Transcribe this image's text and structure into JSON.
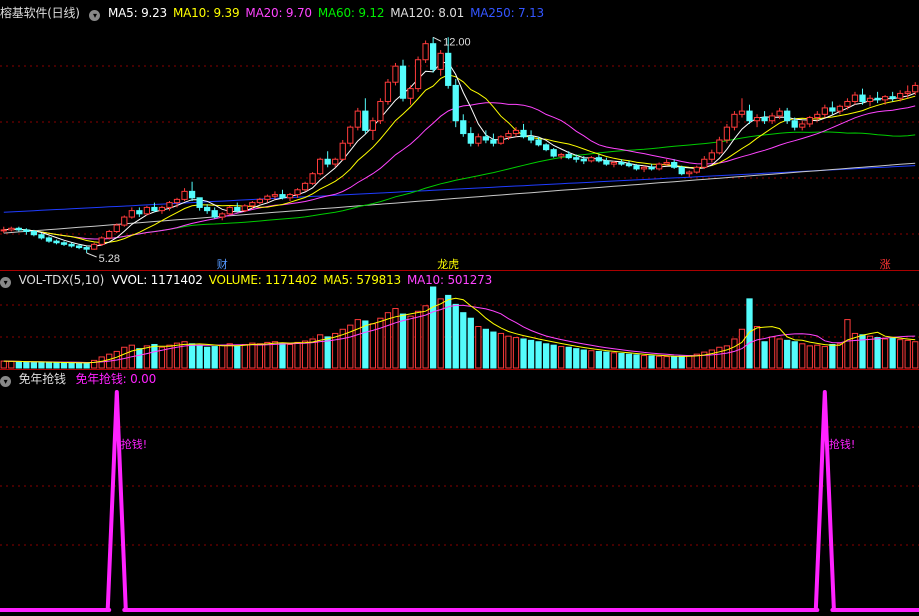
{
  "panel_price": {
    "title": "榕基软件(日线)",
    "ma_labels": [
      {
        "text": "MA5: 9.23",
        "color": "#ffffff"
      },
      {
        "text": "MA10: 9.39",
        "color": "#ffff00"
      },
      {
        "text": "MA20: 9.70",
        "color": "#ff44ff"
      },
      {
        "text": "MA60: 9.12",
        "color": "#00ee00"
      },
      {
        "text": "MA120: 8.01",
        "color": "#dddddd"
      },
      {
        "text": "MA250: 7.13",
        "color": "#3355ff"
      }
    ]
  },
  "panel_volume": {
    "title": "VOL-TDX(5,10)",
    "labels": [
      {
        "text": "VVOL: 1171402",
        "color": "#ffffff"
      },
      {
        "text": "VOLUME: 1171402",
        "color": "#ffff00"
      },
      {
        "text": "MA5: 579813",
        "color": "#ffff00"
      },
      {
        "text": "MA10: 501273",
        "color": "#ff44ff"
      }
    ]
  },
  "panel_indicator": {
    "title": "免年抢钱",
    "value_label": "免年抢钱: 0.00",
    "signal_text": "抢钱!"
  },
  "event_markers": [
    {
      "text": "财",
      "bar": 29,
      "color": "#5599ff"
    },
    {
      "text": "龙虎",
      "bar": 59,
      "color": "#ffff00"
    },
    {
      "text": "涨",
      "bar": 117,
      "color": "#ff3333"
    }
  ],
  "colors": {
    "up": "#ff3b3b",
    "down": "#54fcfc",
    "ma5": "#ffffff",
    "ma10": "#ffff00",
    "ma20": "#ff44ff",
    "ma60": "#00cc00",
    "ma120": "#c8c8c8",
    "ma250": "#1f3cff",
    "signal": "#ff22ff",
    "grid": "#8a0000"
  },
  "chart_data": [
    {
      "type": "candlestick",
      "title": "榕基软件(日线)",
      "high_label": "12.00",
      "low_label": "5.28",
      "ylim": [
        5.0,
        12.6
      ],
      "ohlc": [
        [
          6.0,
          6.1,
          5.9,
          6.0
        ],
        [
          6.0,
          6.1,
          5.95,
          6.05
        ],
        [
          6.05,
          6.1,
          5.95,
          6.0
        ],
        [
          6.0,
          6.05,
          5.85,
          5.95
        ],
        [
          5.95,
          6.0,
          5.8,
          5.85
        ],
        [
          5.85,
          5.9,
          5.7,
          5.75
        ],
        [
          5.75,
          5.8,
          5.6,
          5.65
        ],
        [
          5.65,
          5.7,
          5.55,
          5.6
        ],
        [
          5.6,
          5.65,
          5.5,
          5.55
        ],
        [
          5.55,
          5.6,
          5.45,
          5.5
        ],
        [
          5.5,
          5.55,
          5.4,
          5.45
        ],
        [
          5.45,
          5.5,
          5.28,
          5.4
        ],
        [
          5.4,
          5.6,
          5.38,
          5.55
        ],
        [
          5.55,
          5.8,
          5.5,
          5.75
        ],
        [
          5.75,
          6.0,
          5.7,
          5.95
        ],
        [
          5.95,
          6.2,
          5.9,
          6.15
        ],
        [
          6.15,
          6.45,
          6.1,
          6.4
        ],
        [
          6.4,
          6.7,
          6.35,
          6.6
        ],
        [
          6.6,
          6.7,
          6.4,
          6.5
        ],
        [
          6.5,
          6.75,
          6.45,
          6.7
        ],
        [
          6.7,
          6.85,
          6.55,
          6.6
        ],
        [
          6.6,
          6.75,
          6.5,
          6.7
        ],
        [
          6.7,
          6.9,
          6.6,
          6.85
        ],
        [
          6.85,
          7.0,
          6.7,
          6.95
        ],
        [
          6.95,
          7.3,
          6.9,
          7.2
        ],
        [
          7.2,
          7.5,
          6.9,
          7.0
        ],
        [
          7.0,
          7.0,
          6.6,
          6.7
        ],
        [
          6.7,
          6.8,
          6.5,
          6.6
        ],
        [
          6.6,
          6.7,
          6.35,
          6.4
        ],
        [
          6.4,
          6.55,
          6.3,
          6.5
        ],
        [
          6.5,
          6.75,
          6.45,
          6.7
        ],
        [
          6.7,
          6.85,
          6.55,
          6.6
        ],
        [
          6.6,
          6.8,
          6.55,
          6.75
        ],
        [
          6.75,
          6.9,
          6.65,
          6.85
        ],
        [
          6.85,
          7.0,
          6.8,
          6.95
        ],
        [
          6.95,
          7.1,
          6.85,
          7.05
        ],
        [
          7.05,
          7.2,
          6.95,
          7.1
        ],
        [
          7.1,
          7.25,
          6.95,
          7.0
        ],
        [
          7.0,
          7.15,
          6.9,
          7.1
        ],
        [
          7.1,
          7.3,
          7.0,
          7.25
        ],
        [
          7.25,
          7.5,
          7.2,
          7.45
        ],
        [
          7.45,
          7.8,
          7.4,
          7.75
        ],
        [
          7.75,
          8.25,
          7.7,
          8.2
        ],
        [
          8.2,
          8.45,
          7.95,
          8.05
        ],
        [
          8.05,
          8.25,
          7.95,
          8.2
        ],
        [
          8.2,
          8.8,
          8.15,
          8.7
        ],
        [
          8.7,
          9.25,
          8.6,
          9.2
        ],
        [
          9.2,
          9.8,
          9.1,
          9.7
        ],
        [
          9.7,
          10.1,
          9.0,
          9.1
        ],
        [
          9.1,
          9.5,
          8.8,
          9.4
        ],
        [
          9.4,
          10.1,
          9.3,
          10.0
        ],
        [
          10.0,
          10.7,
          9.9,
          10.6
        ],
        [
          10.6,
          11.2,
          10.5,
          11.1
        ],
        [
          11.1,
          11.3,
          10.0,
          10.1
        ],
        [
          10.1,
          10.5,
          9.9,
          10.4
        ],
        [
          10.4,
          11.4,
          10.3,
          11.3
        ],
        [
          11.3,
          11.9,
          11.2,
          11.8
        ],
        [
          11.8,
          12.0,
          10.9,
          11.0
        ],
        [
          11.0,
          11.6,
          10.8,
          11.5
        ],
        [
          11.5,
          12.0,
          10.4,
          10.5
        ],
        [
          10.5,
          10.7,
          9.2,
          9.4
        ],
        [
          9.4,
          9.6,
          8.9,
          9.0
        ],
        [
          9.0,
          9.2,
          8.6,
          8.7
        ],
        [
          8.7,
          9.0,
          8.6,
          8.9
        ],
        [
          8.9,
          9.1,
          8.7,
          8.8
        ],
        [
          8.8,
          9.0,
          8.6,
          8.7
        ],
        [
          8.7,
          8.95,
          8.65,
          8.9
        ],
        [
          8.9,
          9.1,
          8.8,
          9.0
        ],
        [
          9.0,
          9.2,
          8.9,
          9.1
        ],
        [
          9.1,
          9.3,
          8.85,
          8.9
        ],
        [
          8.9,
          9.1,
          8.7,
          8.8
        ],
        [
          8.8,
          8.9,
          8.6,
          8.65
        ],
        [
          8.65,
          8.7,
          8.45,
          8.5
        ],
        [
          8.5,
          8.55,
          8.25,
          8.3
        ],
        [
          8.3,
          8.4,
          8.2,
          8.35
        ],
        [
          8.35,
          8.45,
          8.2,
          8.25
        ],
        [
          8.25,
          8.35,
          8.1,
          8.2
        ],
        [
          8.2,
          8.3,
          8.05,
          8.15
        ],
        [
          8.15,
          8.3,
          8.1,
          8.25
        ],
        [
          8.25,
          8.35,
          8.1,
          8.15
        ],
        [
          8.15,
          8.25,
          8.0,
          8.05
        ],
        [
          8.05,
          8.15,
          7.95,
          8.1
        ],
        [
          8.1,
          8.2,
          8.0,
          8.05
        ],
        [
          8.05,
          8.15,
          7.95,
          8.0
        ],
        [
          8.0,
          8.05,
          7.85,
          7.9
        ],
        [
          7.9,
          8.0,
          7.8,
          7.95
        ],
        [
          7.95,
          8.05,
          7.85,
          7.9
        ],
        [
          7.9,
          8.1,
          7.85,
          8.05
        ],
        [
          8.05,
          8.2,
          8.0,
          8.1
        ],
        [
          8.1,
          8.2,
          7.9,
          7.95
        ],
        [
          7.95,
          8.0,
          7.7,
          7.75
        ],
        [
          7.75,
          7.85,
          7.65,
          7.8
        ],
        [
          7.8,
          8.0,
          7.75,
          7.95
        ],
        [
          7.95,
          8.3,
          7.9,
          8.2
        ],
        [
          8.2,
          8.5,
          8.1,
          8.4
        ],
        [
          8.4,
          8.9,
          8.35,
          8.8
        ],
        [
          8.8,
          9.3,
          8.7,
          9.2
        ],
        [
          9.2,
          9.7,
          9.1,
          9.6
        ],
        [
          9.6,
          10.1,
          9.5,
          9.7
        ],
        [
          9.7,
          9.9,
          9.3,
          9.4
        ],
        [
          9.4,
          9.6,
          9.2,
          9.5
        ],
        [
          9.5,
          9.7,
          9.3,
          9.4
        ],
        [
          9.4,
          9.65,
          9.3,
          9.55
        ],
        [
          9.55,
          9.8,
          9.45,
          9.7
        ],
        [
          9.7,
          9.8,
          9.3,
          9.4
        ],
        [
          9.4,
          9.5,
          9.1,
          9.2
        ],
        [
          9.2,
          9.4,
          9.1,
          9.3
        ],
        [
          9.3,
          9.55,
          9.2,
          9.5
        ],
        [
          9.5,
          9.7,
          9.4,
          9.6
        ],
        [
          9.6,
          9.9,
          9.5,
          9.8
        ],
        [
          9.8,
          10.0,
          9.6,
          9.7
        ],
        [
          9.7,
          9.9,
          9.6,
          9.85
        ],
        [
          9.85,
          10.1,
          9.75,
          10.0
        ],
        [
          10.0,
          10.3,
          9.9,
          10.2
        ],
        [
          10.2,
          10.4,
          9.9,
          10.0
        ],
        [
          10.0,
          10.2,
          9.85,
          10.1
        ],
        [
          10.1,
          10.3,
          9.95,
          10.05
        ],
        [
          10.05,
          10.2,
          9.9,
          10.15
        ],
        [
          10.15,
          10.3,
          10.0,
          10.1
        ],
        [
          10.1,
          10.35,
          10.0,
          10.25
        ],
        [
          10.25,
          10.5,
          10.1,
          10.3
        ],
        [
          10.3,
          10.6,
          10.2,
          10.5
        ]
      ],
      "series": [
        {
          "name": "MA5",
          "value": 9.23
        },
        {
          "name": "MA10",
          "value": 9.39
        },
        {
          "name": "MA20",
          "value": 9.7
        },
        {
          "name": "MA60",
          "value": 9.12
        },
        {
          "name": "MA120",
          "value": 8.01
        },
        {
          "name": "MA250",
          "value": 7.13
        }
      ]
    },
    {
      "type": "bar",
      "title": "VOL-TDX(5,10)",
      "values": [
        100000,
        95000,
        90000,
        88000,
        85000,
        82000,
        80000,
        78000,
        76000,
        75000,
        72000,
        70000,
        110000,
        160000,
        200000,
        240000,
        300000,
        330000,
        280000,
        320000,
        340000,
        300000,
        330000,
        360000,
        380000,
        350000,
        320000,
        300000,
        310000,
        330000,
        350000,
        320000,
        340000,
        360000,
        350000,
        370000,
        380000,
        360000,
        340000,
        370000,
        390000,
        420000,
        480000,
        450000,
        500000,
        560000,
        620000,
        700000,
        680000,
        640000,
        720000,
        800000,
        860000,
        780000,
        750000,
        820000,
        900000,
        1171402,
        1000000,
        1050000,
        920000,
        800000,
        720000,
        600000,
        560000,
        520000,
        500000,
        460000,
        440000,
        420000,
        400000,
        380000,
        350000,
        330000,
        310000,
        300000,
        280000,
        260000,
        250000,
        240000,
        230000,
        220000,
        210000,
        200000,
        190000,
        180000,
        175000,
        170000,
        165000,
        160000,
        170000,
        180000,
        200000,
        230000,
        260000,
        300000,
        320000,
        420000,
        560000,
        1000000,
        600000,
        380000,
        450000,
        420000,
        400000,
        380000,
        350000,
        320000,
        330000,
        310000,
        340000,
        350000,
        700000,
        500000,
        480000,
        460000,
        440000,
        420000,
        430000,
        410000,
        400000,
        380000
      ],
      "ma5": 579813,
      "ma10": 501273
    },
    {
      "type": "line",
      "title": "免年抢钱",
      "signal_bars": [
        15,
        109
      ],
      "values_note_label": "抢钱!",
      "current_value": 0.0
    }
  ]
}
